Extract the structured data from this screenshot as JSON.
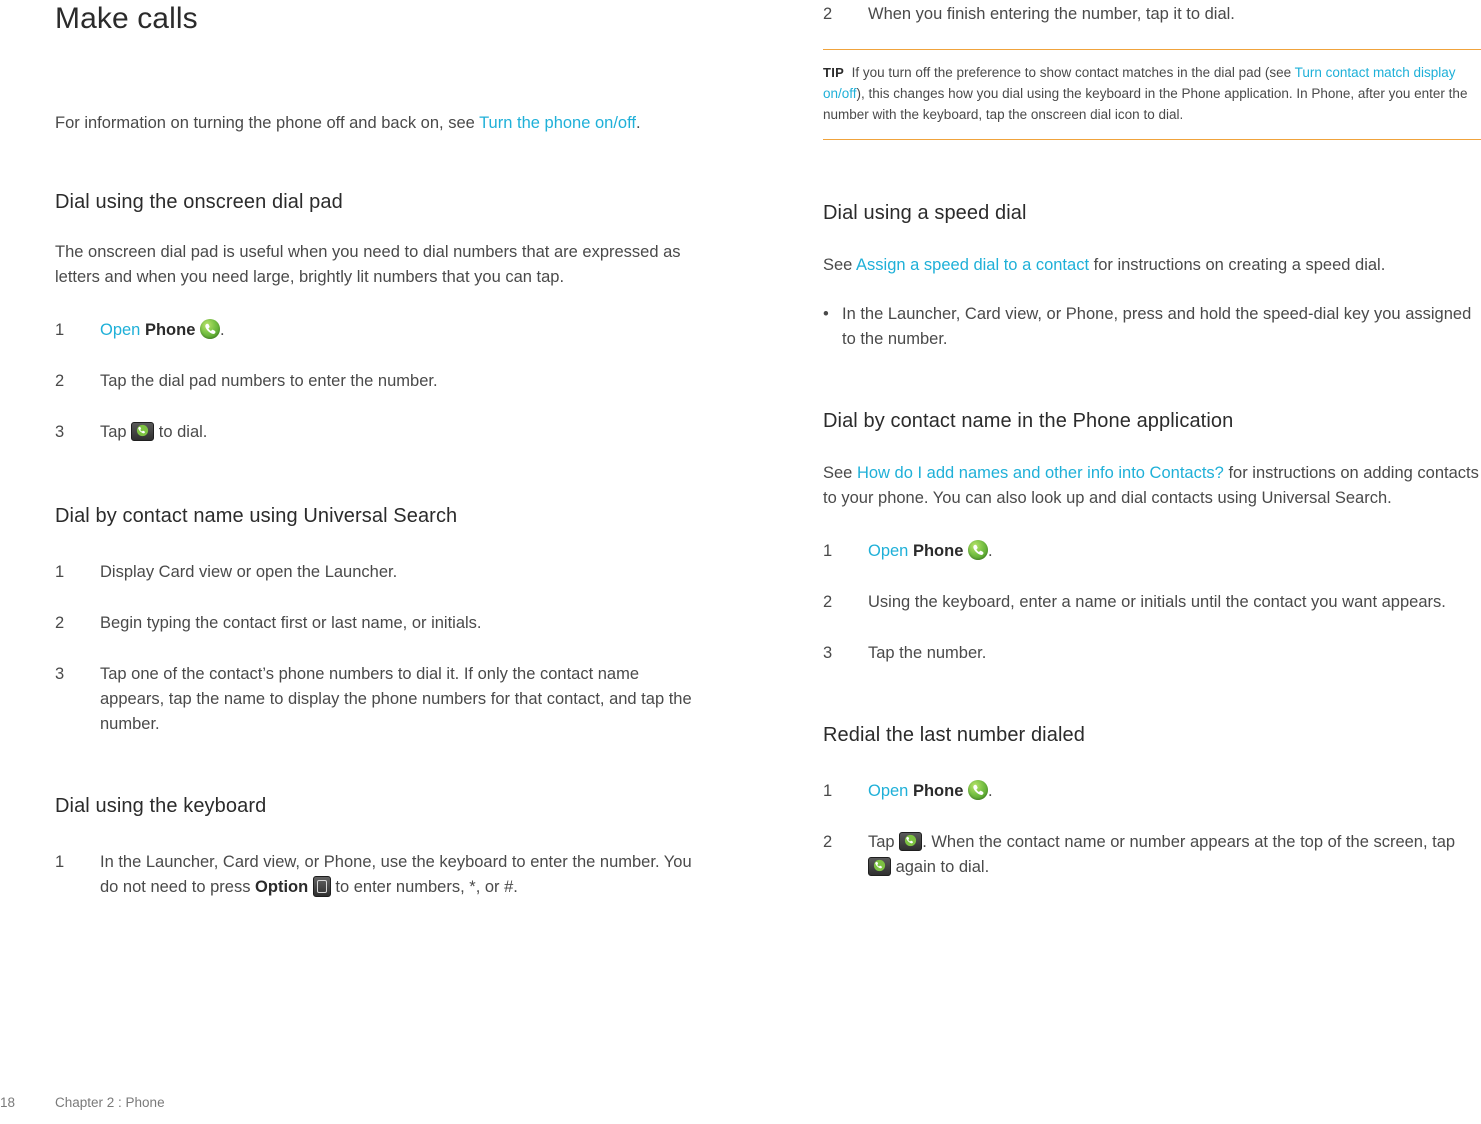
{
  "left": {
    "title": "Make calls",
    "intro": {
      "pre": "For information on turning the phone off and back on, see ",
      "link": "Turn the phone on/off",
      "post": "."
    },
    "sections": [
      {
        "heading": "Dial using the onscreen dial pad",
        "body": "The onscreen dial pad is useful when you need to dial numbers that are expressed as letters and when you need large, brightly lit numbers that you can tap.",
        "steps": [
          {
            "num": "1",
            "pre": "",
            "link": "Open",
            "bold": "Phone",
            "post": "."
          },
          {
            "num": "2",
            "text": "Tap the dial pad numbers to enter the number."
          },
          {
            "num": "3",
            "pre": "Tap ",
            "post": " to dial."
          }
        ]
      },
      {
        "heading": "Dial by contact name using Universal Search",
        "steps": [
          {
            "num": "1",
            "text": "Display Card view or open the Launcher."
          },
          {
            "num": "2",
            "text": "Begin typing the contact first or last name, or initials."
          },
          {
            "num": "3",
            "text": "Tap one of the contact’s phone numbers to dial it. If only the contact name appears, tap the name to display the phone numbers for that contact, and tap the number."
          }
        ]
      },
      {
        "heading": "Dial using the keyboard",
        "steps": [
          {
            "num": "1",
            "pre": "In the Launcher, Card view, or Phone, use the keyboard to enter the number. You do not need to press ",
            "bold": "Option",
            "post": " to enter numbers, *, or #."
          }
        ]
      }
    ]
  },
  "right": {
    "top_step": {
      "num": "2",
      "text": "When you finish entering the number, tap it to dial."
    },
    "tip": {
      "label": "TIP",
      "pre": "If you turn off the preference to show contact matches in the dial pad (see ",
      "link": "Turn contact match display on/off",
      "post": "), this changes how you dial using the keyboard in the Phone application. In Phone, after you enter the number with the keyboard, tap the onscreen dial icon to dial."
    },
    "sections": [
      {
        "heading": "Dial using a speed dial",
        "body_pre": "See ",
        "body_link": "Assign a speed dial to a contact",
        "body_post": " for instructions on creating a speed dial.",
        "bullet": "In the Launcher, Card view, or Phone, press and hold the speed-dial key you assigned to the number."
      },
      {
        "heading": "Dial by contact name in the Phone application",
        "body_pre": "See ",
        "body_link": "How do I add names and other info into Contacts?",
        "body_post": " for instructions on adding contacts to your phone. You can also look up and dial contacts using Universal Search.",
        "steps": [
          {
            "num": "1",
            "link": "Open",
            "bold": "Phone",
            "post": "."
          },
          {
            "num": "2",
            "text": "Using the keyboard, enter a name or initials until the contact you want appears."
          },
          {
            "num": "3",
            "text": "Tap the number."
          }
        ]
      },
      {
        "heading": "Redial the last number dialed",
        "steps": [
          {
            "num": "1",
            "link": "Open",
            "bold": "Phone",
            "post": "."
          },
          {
            "num": "2",
            "pre": "Tap ",
            "mid": ". When the contact name or number appears at the top of the screen, tap ",
            "post": " again to dial."
          }
        ]
      }
    ]
  },
  "footer": {
    "page_number": "18",
    "chapter": "Chapter 2 : Phone"
  },
  "colors": {
    "link": "#1fb0d8",
    "tip_rule": "#f0a33c",
    "text": "#4a4a4a",
    "heading": "#2b2b2b"
  }
}
